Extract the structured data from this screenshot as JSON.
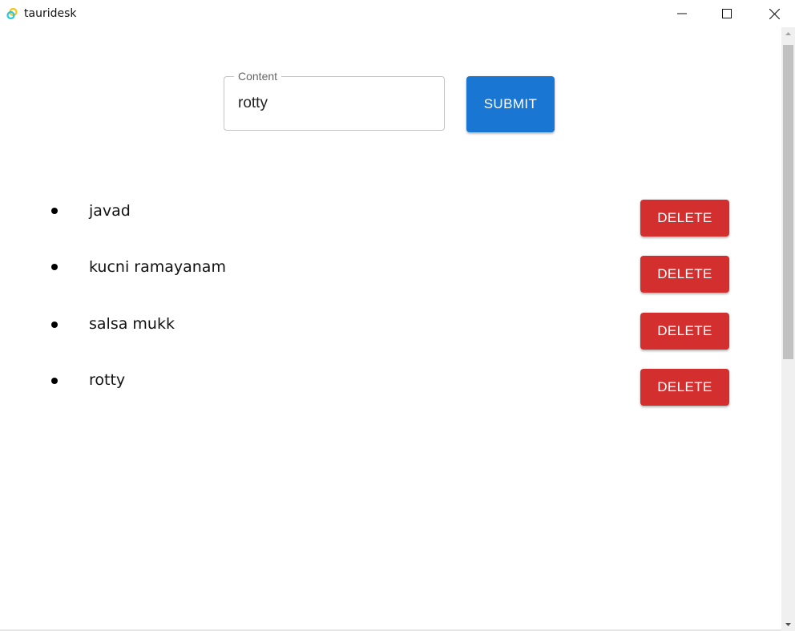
{
  "window": {
    "title": "tauridesk",
    "icon": "tauri-logo-icon",
    "controls": [
      "minimize-icon",
      "maximize-icon",
      "close-icon"
    ]
  },
  "form": {
    "label": "Content",
    "value": "rotty",
    "submit_label": "SUBMIT"
  },
  "items": [
    {
      "text": "javad",
      "delete_label": "DELETE"
    },
    {
      "text": "kucni ramayanam",
      "delete_label": "DELETE"
    },
    {
      "text": "salsa mukk",
      "delete_label": "DELETE"
    },
    {
      "text": "rotty",
      "delete_label": "DELETE"
    }
  ],
  "colors": {
    "primary": "#1976d2",
    "danger": "#d32f2f",
    "scrollbar_track": "#f0f0f0",
    "scrollbar_thumb": "#c1c1c1"
  }
}
